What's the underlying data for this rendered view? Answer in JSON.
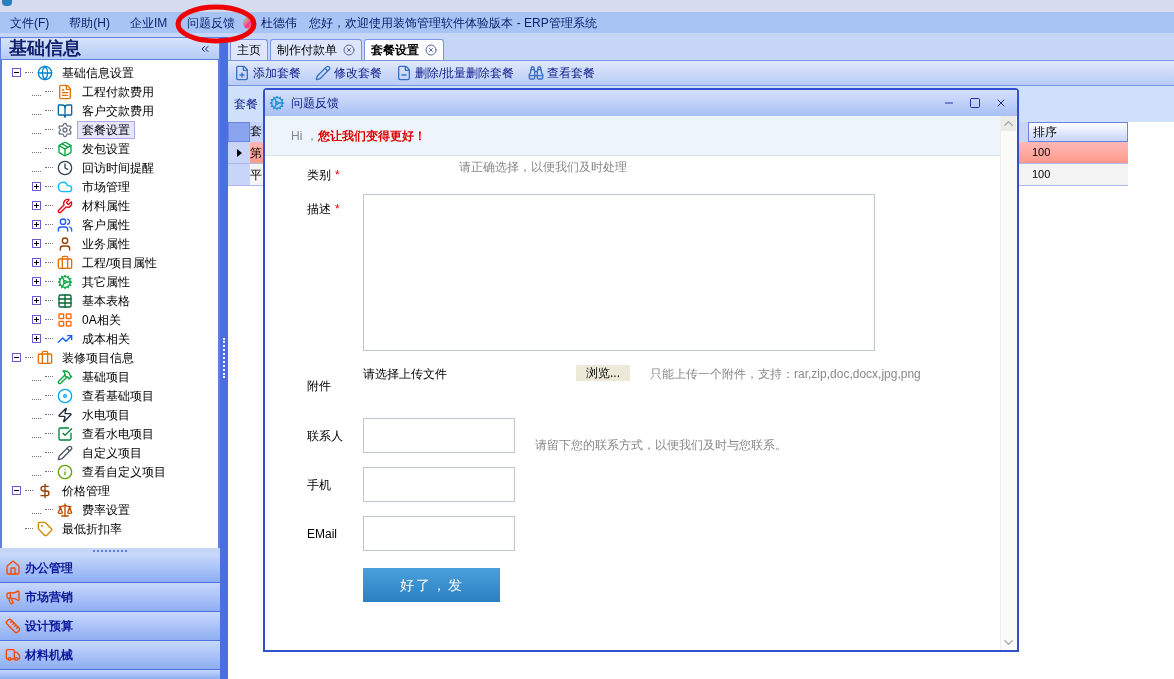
{
  "menu": [
    {
      "label": "文件(F)"
    },
    {
      "label": "帮助(H)"
    },
    {
      "label": "企业IM"
    },
    {
      "label": "问题反馈",
      "circled": true
    }
  ],
  "user": {
    "name": "杜德伟",
    "greeting": "您好，欢迎使用装饰管理软件体验版本 - ERP管理系统"
  },
  "sidebar": {
    "title": "基础信息",
    "tree": [
      {
        "label": "基础信息设置",
        "kind": "folder",
        "expanded": true,
        "selected": false,
        "children": [
          {
            "label": "工程付款费用",
            "kind": "leaf",
            "selected": false
          },
          {
            "label": "客户交款费用",
            "kind": "leaf",
            "selected": false
          },
          {
            "label": "套餐设置",
            "kind": "leaf",
            "selected": true
          },
          {
            "label": "发包设置",
            "kind": "leaf",
            "selected": false
          },
          {
            "label": "回访时间提醒",
            "kind": "leaf",
            "selected": false
          },
          {
            "label": "市场管理",
            "kind": "folder",
            "expanded": false,
            "selected": false
          },
          {
            "label": "材料属性",
            "kind": "folder",
            "expanded": false,
            "selected": false
          },
          {
            "label": "客户属性",
            "kind": "folder",
            "expanded": false,
            "selected": false
          },
          {
            "label": "业务属性",
            "kind": "folder",
            "expanded": false,
            "selected": false
          },
          {
            "label": "工程/项目属性",
            "kind": "folder",
            "expanded": false,
            "selected": false
          },
          {
            "label": "其它属性",
            "kind": "folder",
            "expanded": false,
            "selected": false
          },
          {
            "label": "基本表格",
            "kind": "folder",
            "expanded": false,
            "selected": false
          },
          {
            "label": "0A相关",
            "kind": "folder",
            "expanded": false,
            "selected": false
          },
          {
            "label": "成本相关",
            "kind": "folder",
            "expanded": false,
            "selected": false
          }
        ]
      },
      {
        "label": "装修项目信息",
        "kind": "folder",
        "expanded": true,
        "selected": false,
        "children": [
          {
            "label": "基础项目",
            "kind": "leaf",
            "selected": false
          },
          {
            "label": "查看基础项目",
            "kind": "leaf",
            "selected": false
          },
          {
            "label": "水电项目",
            "kind": "leaf",
            "selected": false
          },
          {
            "label": "查看水电项目",
            "kind": "leaf",
            "selected": false
          },
          {
            "label": "自定义项目",
            "kind": "leaf",
            "selected": false
          },
          {
            "label": "查看自定义项目",
            "kind": "leaf",
            "selected": false
          }
        ]
      },
      {
        "label": "价格管理",
        "kind": "folder",
        "expanded": true,
        "selected": false,
        "children": [
          {
            "label": "费率设置",
            "kind": "leaf",
            "selected": false
          }
        ]
      },
      {
        "label": "最低折扣率",
        "kind": "root-leaf",
        "selected": false
      }
    ],
    "sections": [
      {
        "label": "办公管理"
      },
      {
        "label": "市场营销"
      },
      {
        "label": "设计预算"
      },
      {
        "label": "材料机械"
      }
    ]
  },
  "tabs": [
    {
      "label": "主页",
      "closable": false,
      "selected": false
    },
    {
      "label": "制作付款单",
      "closable": true,
      "selected": false
    },
    {
      "label": "套餐设置",
      "closable": true,
      "selected": true
    }
  ],
  "toolbar": [
    {
      "label": "添加套餐"
    },
    {
      "label": "修改套餐"
    },
    {
      "label": "删除/批量删除套餐"
    },
    {
      "label": "查看套餐"
    }
  ],
  "pane_label": "套餐",
  "table": {
    "columns": [
      "套",
      "排序"
    ],
    "rows": [
      {
        "cells": [
          "第",
          "100"
        ],
        "selected": true
      },
      {
        "cells": [
          "平",
          "100"
        ],
        "selected": false
      }
    ]
  },
  "dialog": {
    "title": "问题反馈",
    "banner": "Hi ，**您让我们变得更好！**",
    "fields": [
      {
        "kind": "select",
        "label": "类别",
        "required_mark": "*",
        "hint": "请正确选择，以便我们及时处理"
      },
      {
        "kind": "textarea",
        "label": "描述",
        "required_mark": "*"
      },
      {
        "kind": "file",
        "label": "附件",
        "value": "请选择上传文件",
        "button": "浏览...",
        "hint": "只能上传一个附件，支持：rar,zip,doc,docx,jpg,png"
      },
      {
        "kind": "text",
        "label": "联系人",
        "hint": "请留下您的联系方式，以便我们及时与您联系。"
      },
      {
        "kind": "text",
        "label": "手机"
      },
      {
        "kind": "text",
        "label": "EMail"
      }
    ],
    "submit": "好了，发"
  }
}
